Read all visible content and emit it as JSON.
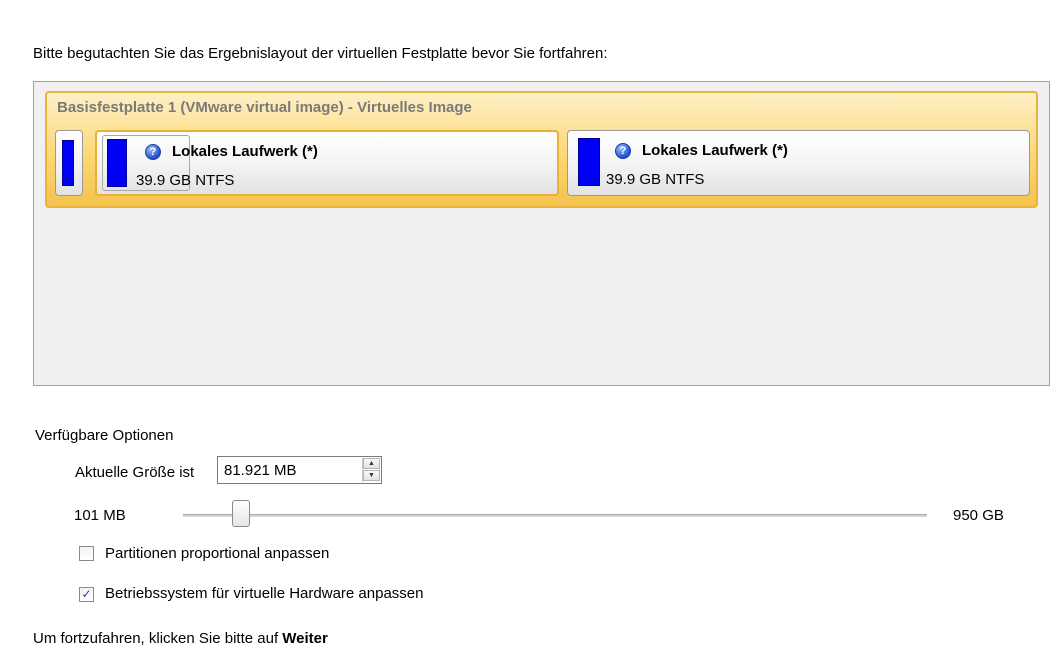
{
  "instruction": "Bitte begutachten Sie das Ergebnislayout der virtuellen Festplatte bevor Sie fortfahren:",
  "disk": {
    "title": "Basisfestplatte 1 (VMware virtual image) - Virtuelles Image",
    "partitions": [
      {
        "name": "Lokales Laufwerk (*)",
        "size": "39.9 GB NTFS",
        "icon": "help-icon",
        "selected": true
      },
      {
        "name": "Lokales Laufwerk (*)",
        "size": "39.9 GB NTFS",
        "icon": "help-icon",
        "selected": false
      }
    ],
    "bar_color": "#0000f5",
    "highlight_color": "#fbd56f"
  },
  "options": {
    "label": "Verfügbare Optionen",
    "size_label": "Aktuelle Größe ist",
    "size_value": "81.921 MB",
    "slider": {
      "min_label": "101 MB",
      "max_label": "950 GB",
      "value_fraction": 0.07
    },
    "checkboxes": [
      {
        "label": "Partitionen proportional anpassen",
        "checked": false
      },
      {
        "label": "Betriebssystem für virtuelle Hardware anpassen",
        "checked": true
      }
    ]
  },
  "continue_hint": {
    "prefix": "Um fortzufahren, klicken Sie bitte auf ",
    "button_name": "Weiter"
  }
}
